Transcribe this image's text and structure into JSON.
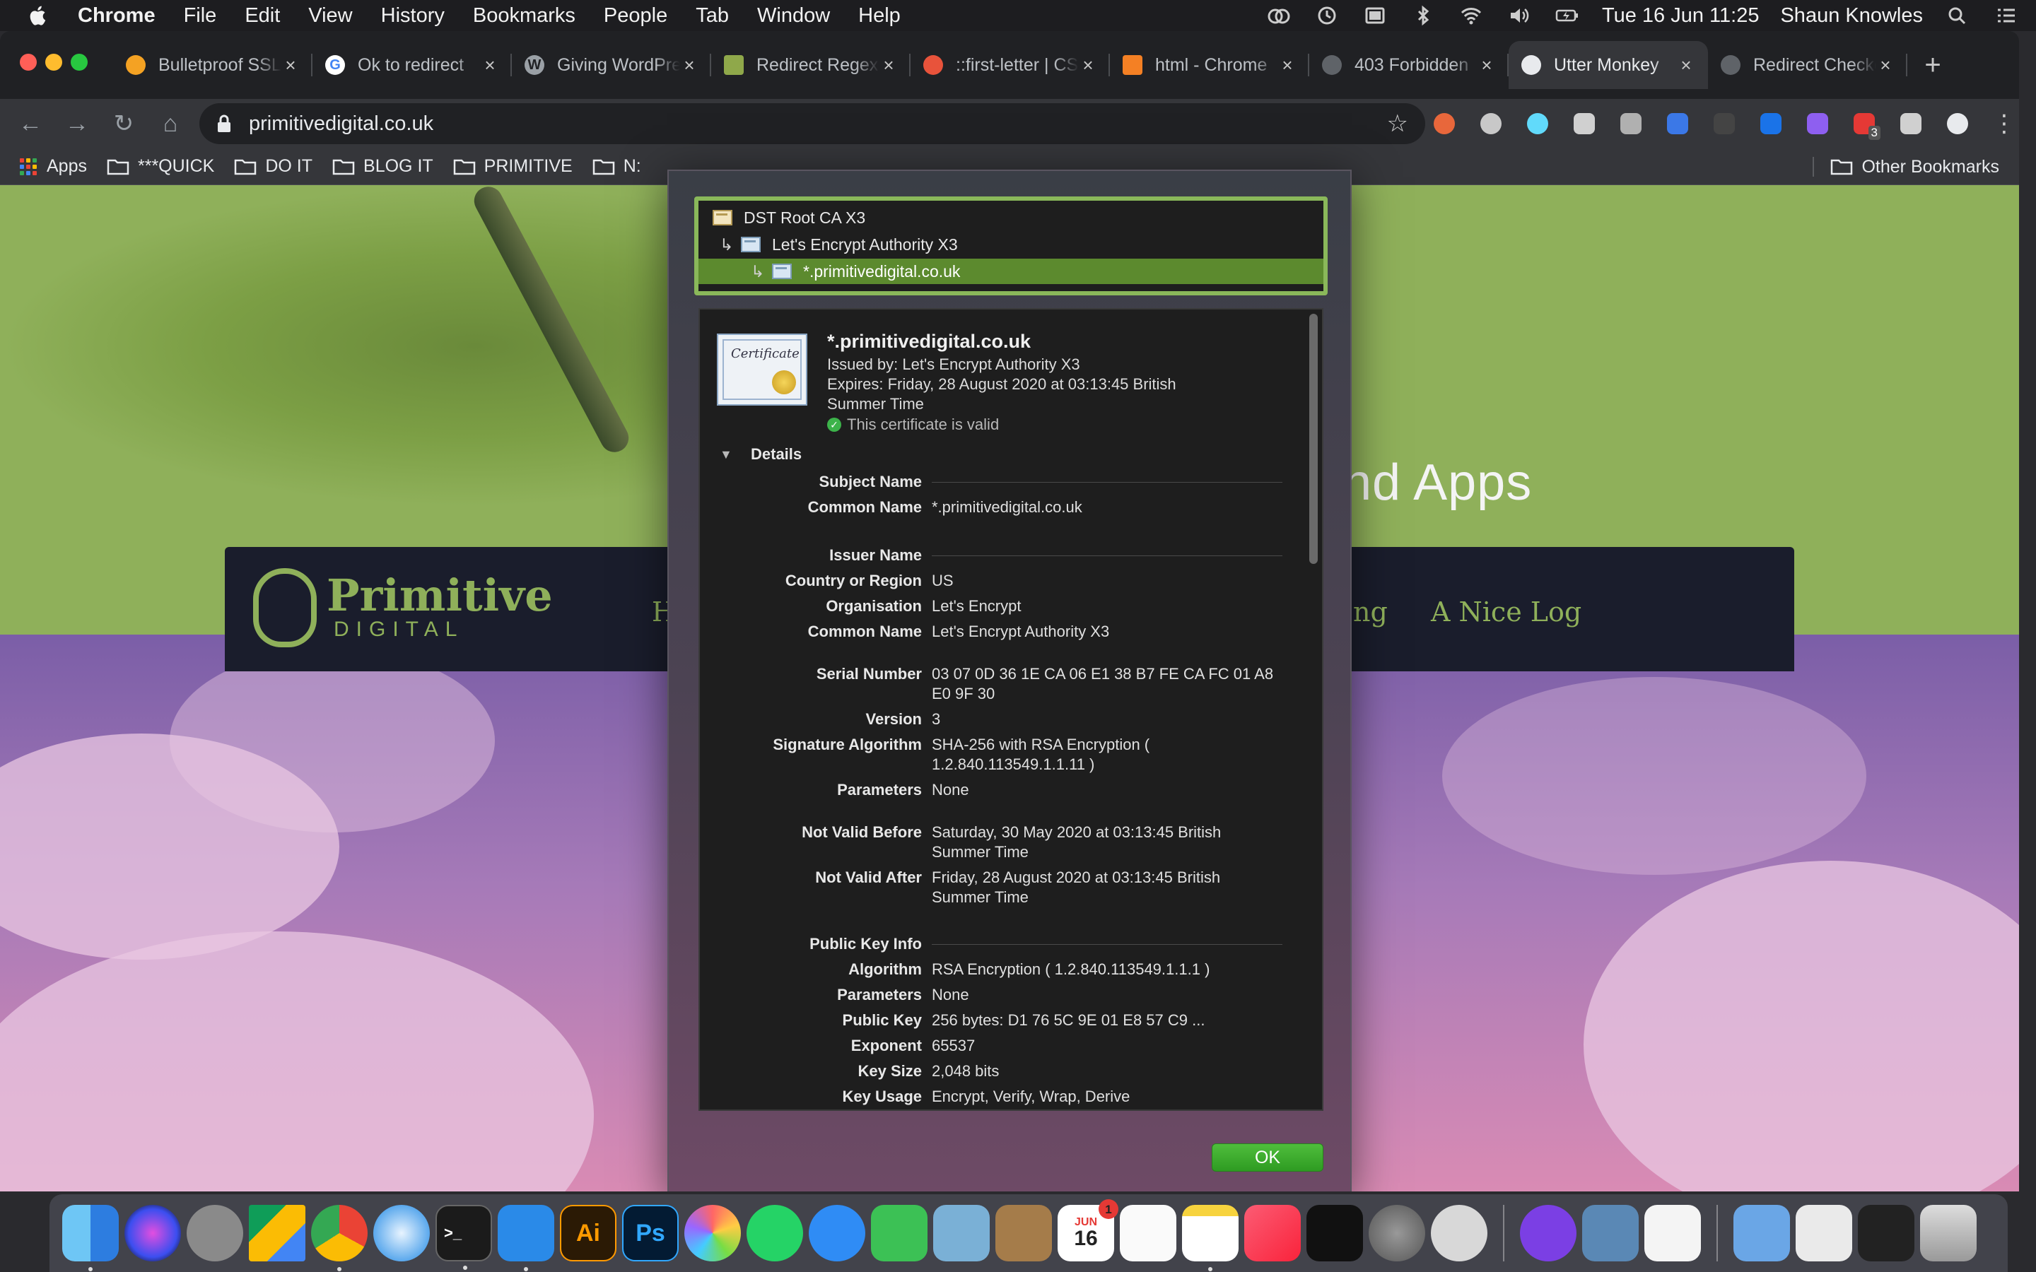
{
  "menubar": {
    "app_name": "Chrome",
    "menus": [
      "File",
      "Edit",
      "View",
      "History",
      "Bookmarks",
      "People",
      "Tab",
      "Window",
      "Help"
    ],
    "datetime": "Tue 16 Jun  11:25",
    "user": "Shaun Knowles"
  },
  "tabs": [
    {
      "title": "Bulletproof SSL",
      "favicon_color": "#f4a223"
    },
    {
      "title": "Ok to redirect",
      "favicon_color": "#ffffff"
    },
    {
      "title": "Giving WordPress",
      "favicon_color": "#9aa0a6"
    },
    {
      "title": "Redirect Regex",
      "favicon_color": "#8fa84a"
    },
    {
      "title": "::first-letter | CSS",
      "favicon_color": "#e8533b"
    },
    {
      "title": "html - Chrome",
      "favicon_color": "#f48024"
    },
    {
      "title": "403 Forbidden",
      "favicon_color": "#5f6368"
    },
    {
      "title": "Utter Monkey",
      "favicon_color": "#e8eaed",
      "active": true
    },
    {
      "title": "Redirect Checker",
      "favicon_color": "#5f6368"
    }
  ],
  "toolbar": {
    "url": "primitivedigital.co.uk"
  },
  "bookmarks": {
    "apps_label": "Apps",
    "items": [
      "***QUICK",
      "DO IT",
      "BLOG IT",
      "PRIMITIVE",
      "N:"
    ],
    "other_label": "Other Bookmarks"
  },
  "site": {
    "tagline_fragment": "nd Apps",
    "logo_primary": "Primitive",
    "logo_secondary": "DIGITAL",
    "nav_first": "H",
    "nav_partial": "ng",
    "nav_last": "A Nice Log"
  },
  "certificate": {
    "chain": [
      {
        "name": "DST Root CA X3"
      },
      {
        "name": "Let's Encrypt Authority X3"
      },
      {
        "name": "*.primitivedigital.co.uk",
        "selected": true
      }
    ],
    "icon_text": "Certificate",
    "title": "*.primitivedigital.co.uk",
    "issued_by": "Issued by: Let's Encrypt Authority X3",
    "expires": "Expires: Friday, 28 August 2020 at 03:13:45 British Summer Time",
    "valid_text": "This certificate is valid",
    "details_label": "Details",
    "subject_name_heading": "Subject Name",
    "subject_common_name_label": "Common Name",
    "subject_common_name": "*.primitivedigital.co.uk",
    "issuer_name_heading": "Issuer Name",
    "country_label": "Country or Region",
    "country": "US",
    "organisation_label": "Organisation",
    "organisation": "Let's Encrypt",
    "issuer_common_name_label": "Common Name",
    "issuer_common_name": "Let's Encrypt Authority X3",
    "serial_label": "Serial Number",
    "serial": "03 07 0D 36 1E CA 06 E1 38 B7 FE CA FC 01 A8 E0 9F 30",
    "version_label": "Version",
    "version": "3",
    "sig_alg_label": "Signature Algorithm",
    "sig_alg": "SHA-256 with RSA Encryption ( 1.2.840.113549.1.1.11 )",
    "params_label": "Parameters",
    "params": "None",
    "not_before_label": "Not Valid Before",
    "not_before": "Saturday, 30 May 2020 at 03:13:45 British Summer Time",
    "not_after_label": "Not Valid After",
    "not_after": "Friday, 28 August 2020 at 03:13:45 British Summer Time",
    "pk_heading": "Public Key Info",
    "pk_alg_label": "Algorithm",
    "pk_alg": "RSA Encryption ( 1.2.840.113549.1.1.1 )",
    "pk_params_label": "Parameters",
    "pk_params": "None",
    "pk_label": "Public Key",
    "pk": "256 bytes: D1 76 5C 9E 01 E8 57 C9 ...",
    "exponent_label": "Exponent",
    "exponent": "65537",
    "key_size_label": "Key Size",
    "key_size": "2,048 bits",
    "key_usage_label": "Key Usage",
    "key_usage": "Encrypt, Verify, Wrap, Derive",
    "ok_label": "OK"
  },
  "dock": {
    "calendar_month": "JUN",
    "calendar_day": "16",
    "calendar_badge": "1",
    "illustrator_label": "Ai",
    "photoshop_label": "Ps",
    "extension_badge": "3"
  }
}
